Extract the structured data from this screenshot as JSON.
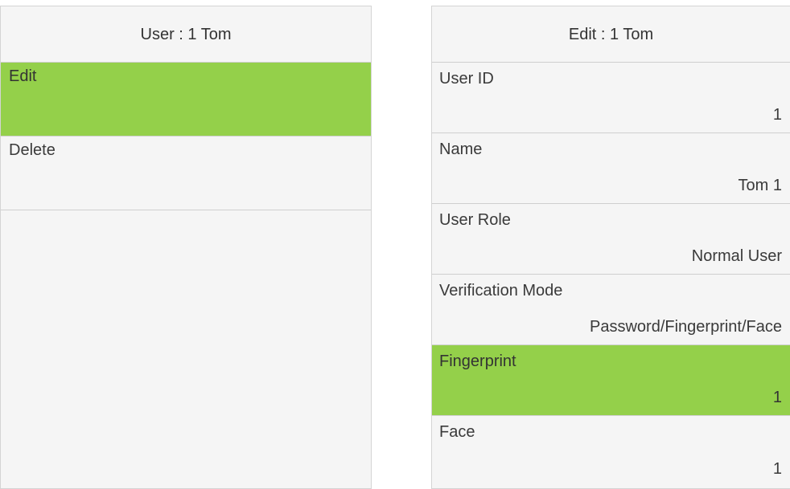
{
  "left_panel": {
    "title": "User : 1 Tom",
    "items": [
      {
        "label": "Edit",
        "selected": true
      },
      {
        "label": "Delete",
        "selected": false
      }
    ]
  },
  "right_panel": {
    "title": "Edit : 1 Tom",
    "fields": [
      {
        "label": "User ID",
        "value": "1"
      },
      {
        "label": "Name",
        "value": "Tom 1"
      },
      {
        "label": "User Role",
        "value": "Normal User"
      },
      {
        "label": "Verification Mode",
        "value": "Password/Fingerprint/Face"
      },
      {
        "label": "Fingerprint",
        "value": "1"
      },
      {
        "label": "Face",
        "value": "1"
      }
    ]
  },
  "colors": {
    "selected_background": "#94d04a",
    "panel_background": "#f5f5f5"
  }
}
